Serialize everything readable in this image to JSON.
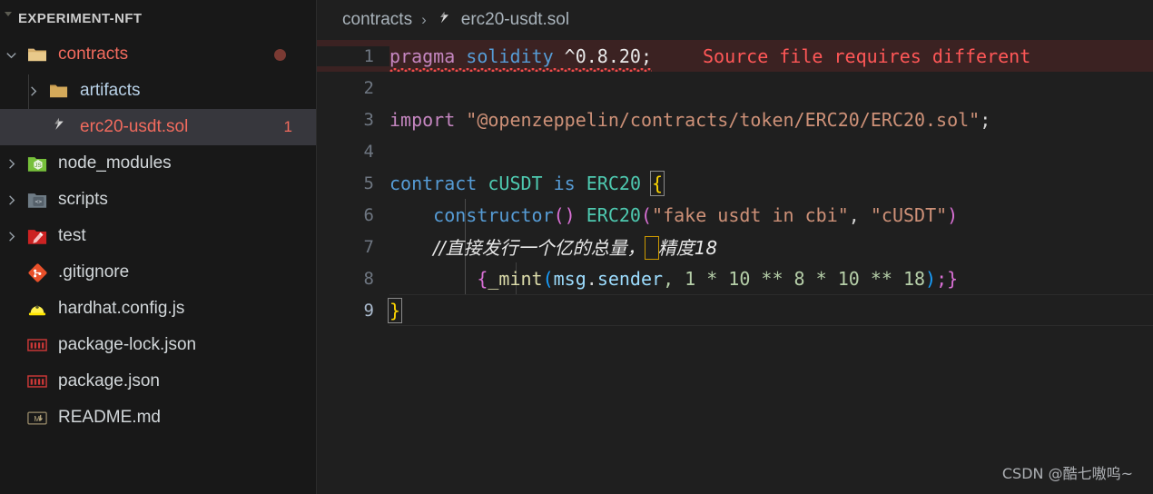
{
  "sidebar": {
    "title": "EXPERIMENT-NFT",
    "items": [
      {
        "label": "contracts",
        "icon": "folder-open-icon",
        "badge": "",
        "kind": "folder",
        "state": "expanded"
      },
      {
        "label": "artifacts",
        "icon": "folder-icon",
        "badge": "",
        "kind": "folder",
        "state": "collapsed"
      },
      {
        "label": "erc20-usdt.sol",
        "icon": "solidity-file-icon",
        "badge": "1",
        "kind": "file",
        "state": "selected"
      },
      {
        "label": "node_modules",
        "icon": "nodejs-folder-icon",
        "badge": "",
        "kind": "folder",
        "state": "collapsed"
      },
      {
        "label": "scripts",
        "icon": "scripts-folder-icon",
        "badge": "",
        "kind": "folder",
        "state": "collapsed"
      },
      {
        "label": "test",
        "icon": "test-folder-icon",
        "badge": "",
        "kind": "folder",
        "state": "collapsed"
      },
      {
        "label": ".gitignore",
        "icon": "git-icon",
        "badge": "",
        "kind": "file",
        "state": ""
      },
      {
        "label": "hardhat.config.js",
        "icon": "hardhat-icon",
        "badge": "",
        "kind": "file",
        "state": ""
      },
      {
        "label": "package-lock.json",
        "icon": "npm-icon",
        "badge": "",
        "kind": "file",
        "state": ""
      },
      {
        "label": "package.json",
        "icon": "npm-icon",
        "badge": "",
        "kind": "file",
        "state": ""
      },
      {
        "label": "README.md",
        "icon": "markdown-icon",
        "badge": "",
        "kind": "file",
        "state": ""
      }
    ]
  },
  "breadcrumb": {
    "folder": "contracts",
    "separator": "›",
    "file": "erc20-usdt.sol",
    "file_icon": "solidity-file-icon"
  },
  "editor": {
    "error_message": "Source file requires different",
    "lines": [
      {
        "num": "1"
      },
      {
        "num": "2"
      },
      {
        "num": "3"
      },
      {
        "num": "4"
      },
      {
        "num": "5"
      },
      {
        "num": "6"
      },
      {
        "num": "7"
      },
      {
        "num": "8"
      },
      {
        "num": "9"
      }
    ],
    "code": {
      "l1_pragma": "pragma",
      "l1_solidity": "solidity",
      "l1_version": "^0.8.20;",
      "l3_import": "import",
      "l3_path": "\"@openzeppelin/contracts/token/ERC20/ERC20.sol\"",
      "l3_semi": ";",
      "l5_contract": "contract",
      "l5_name": "cUSDT",
      "l5_is": "is",
      "l5_base": "ERC20",
      "l5_brace": "{",
      "l6_ctor": "constructor",
      "l6_ctor_parens": "()",
      "l6_erc20": "ERC20",
      "l6_open": "(",
      "l6_arg1": "\"fake usdt in cbi\"",
      "l6_comma": ", ",
      "l6_arg2": "\"cUSDT\"",
      "l6_close": ")",
      "l7_comment_a": "//直接发行一个亿的总量，",
      "l7_comment_hl": " ",
      "l7_comment_b": "精度18",
      "l8_brace": "{",
      "l8_mint": "_mint",
      "l8_open": "(",
      "l8_msg": "msg",
      "l8_dot": ".",
      "l8_sender": "sender",
      "l8_rest": ", 1 * 10 ** 8 * 10 ** 18",
      "l8_close": ")",
      "l8_end": ";}",
      "l9_brace": "}"
    }
  },
  "watermark": "CSDN @酷七嗷呜~",
  "colors": {
    "sidebar_bg": "#181818",
    "editor_bg": "#1f1f1f",
    "selected_row_bg": "#37373d",
    "error_bg": "#3b2222",
    "error_text": "#ff5757",
    "file_red": "#f26b5e",
    "folder_blue": "#b9d2e8"
  }
}
